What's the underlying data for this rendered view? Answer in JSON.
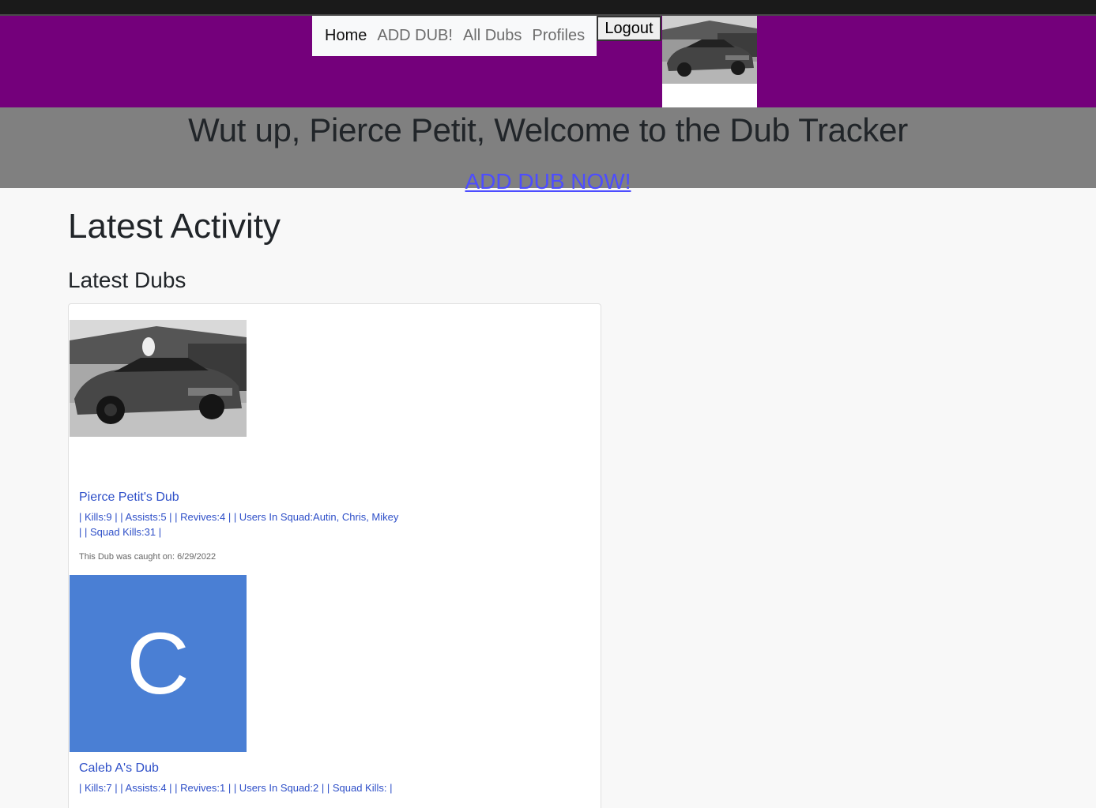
{
  "nav": {
    "items": [
      {
        "label": "Home",
        "active": true
      },
      {
        "label": "ADD DUB!",
        "active": false
      },
      {
        "label": "All Dubs",
        "active": false
      },
      {
        "label": "Profiles",
        "active": false
      }
    ],
    "logout_label": "Logout"
  },
  "banner": {
    "welcome": "Wut up, Pierce Petit, Welcome to the Dub Tracker",
    "cta": "ADD DUB NOW!"
  },
  "main": {
    "title": "Latest Activity",
    "subtitle": "Latest Dubs"
  },
  "dubs": [
    {
      "title": "Pierce Petit's Dub",
      "stats_line1": "| Kills:9 | | Assists:5 | | Revives:4 | | Users In Squad:Autin, Chris, Mikey",
      "stats_line2": "| | Squad Kills:31 |",
      "date": "This Dub was caught on: 6/29/2022",
      "image": "car-photo"
    },
    {
      "title": "Caleb A's Dub",
      "stats_line1": "| Kills:7 | | Assists:4 | | Revives:1 | | Users In Squad:2 | | Squad Kills: |",
      "avatar_letter": "C",
      "image": "letter-avatar"
    }
  ],
  "colors": {
    "header_purple": "#74007b",
    "banner_gray": "#808080",
    "link_blue": "#4d4dff",
    "card_link_blue": "#2e4fc8",
    "avatar_blue": "#4a7fd4"
  }
}
